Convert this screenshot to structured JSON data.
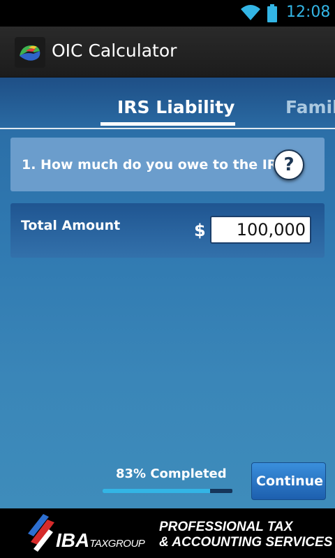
{
  "status_bar": {
    "time": "12:08",
    "icons": [
      "wifi-icon",
      "battery-icon"
    ],
    "accent_color": "#33b5e5"
  },
  "action_bar": {
    "app_title": "OIC Calculator"
  },
  "tabs": [
    {
      "label": "IRS Liability",
      "active": true
    },
    {
      "label": "Family",
      "active": false
    }
  ],
  "question": {
    "text": "1. How much do you owe to the IRS?",
    "help_symbol": "?"
  },
  "amount": {
    "label": "Total Amount",
    "currency": "$",
    "value": "100,000"
  },
  "progress": {
    "label": "83% Completed",
    "percent": 83
  },
  "continue_button": {
    "label": "Continue"
  },
  "footer": {
    "logo_main": "IBA",
    "logo_sub": "TAXGROUP",
    "slogan_line1": "PROFESSIONAL TAX",
    "slogan_line2": "& ACCOUNTING SERVICES"
  }
}
